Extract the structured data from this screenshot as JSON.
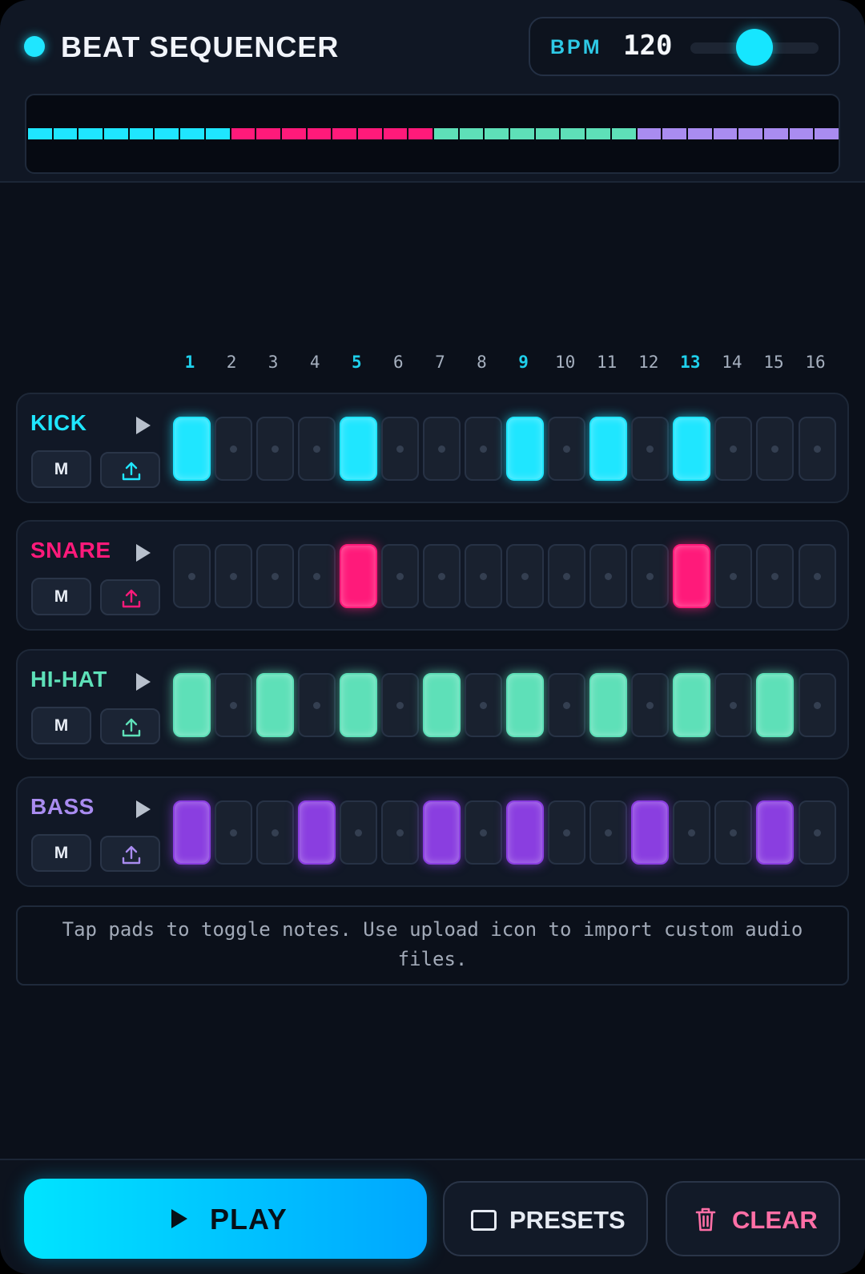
{
  "header": {
    "title": "BEAT SEQUENCER",
    "bpm_label": "BPM",
    "bpm_value": "120",
    "bpm_slider_level": 0.5
  },
  "steps": [
    "1",
    "2",
    "3",
    "4",
    "5",
    "6",
    "7",
    "8",
    "9",
    "10",
    "11",
    "12",
    "13",
    "14",
    "15",
    "16"
  ],
  "accent_steps": [
    1,
    5,
    9,
    13
  ],
  "tracks": [
    {
      "name": "KICK",
      "color": "#1fe6ff",
      "mute_label": "M",
      "pattern": [
        1,
        0,
        0,
        0,
        1,
        0,
        0,
        0,
        1,
        0,
        1,
        0,
        1,
        0,
        0,
        0
      ]
    },
    {
      "name": "SNARE",
      "color": "#ff1a7a",
      "mute_label": "M",
      "pattern": [
        0,
        0,
        0,
        0,
        1,
        0,
        0,
        0,
        0,
        0,
        0,
        0,
        1,
        0,
        0,
        0
      ]
    },
    {
      "name": "HI-HAT",
      "color": "#5ee0b8",
      "mute_label": "M",
      "pattern": [
        1,
        0,
        1,
        0,
        1,
        0,
        1,
        0,
        1,
        0,
        1,
        0,
        1,
        0,
        1,
        0
      ]
    },
    {
      "name": "BASS",
      "color": "#8a3ee0",
      "name_color": "#a98cf0",
      "mute_label": "M",
      "pattern": [
        1,
        0,
        0,
        1,
        0,
        0,
        1,
        0,
        1,
        0,
        0,
        1,
        0,
        0,
        1,
        0
      ]
    }
  ],
  "timeline_colors": [
    "#1fe6ff",
    "#ff1a7a",
    "#5ee0b8",
    "#a98cf0"
  ],
  "hint": "Tap pads to toggle notes. Use upload icon to import custom audio files.",
  "footer": {
    "play_label": "PLAY",
    "presets_label": "PRESETS",
    "clear_label": "CLEAR"
  }
}
